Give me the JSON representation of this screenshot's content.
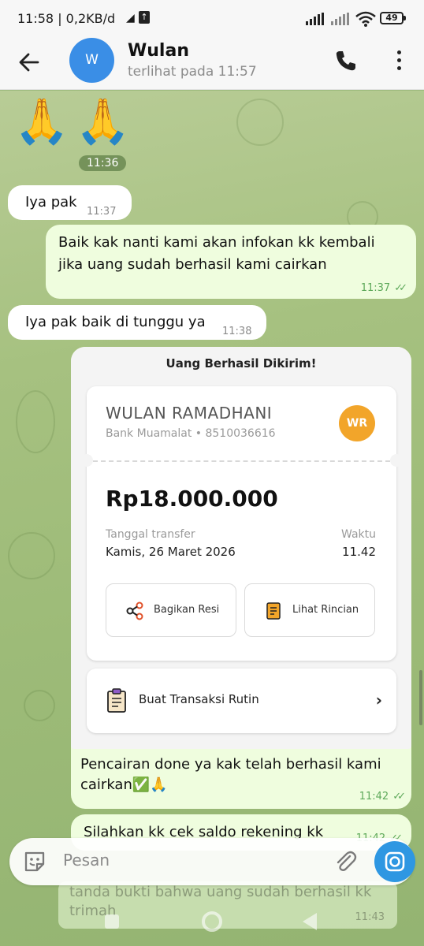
{
  "status_bar": {
    "time": "11:58 | 0,2KB/d",
    "battery": "49"
  },
  "header": {
    "avatar_initial": "W",
    "name": "Wulan",
    "status": "terlihat pada  11:57"
  },
  "messages": {
    "emoji": "🙏🙏",
    "emoji_time": "11:36",
    "m1": {
      "text": "Iya pak",
      "time": "11:37"
    },
    "m2": {
      "line1": "Baik kak nanti kami akan infokan kk kembali",
      "line2": "jika uang sudah berhasil kami cairkan",
      "time": "11:37"
    },
    "m3": {
      "text": "Iya pak baik di tunggu ya",
      "time": "11:38"
    },
    "m4": {
      "line1": "Pencairan done ya kak telah berhasil kami",
      "line2": "cairkan✅🙏",
      "time": "11:42"
    },
    "m5": {
      "text": "Silahkan kk cek saldo rekening kk",
      "time": "11:42"
    },
    "m6": {
      "line1": "tanda bukti bahwa uang sudah berhasil kk",
      "line2": "trimah",
      "time": "11:43"
    }
  },
  "receipt": {
    "title": "Uang Berhasil Dikirim!",
    "recipient_name": "WULAN RAMADHANI",
    "bank": "Bank Muamalat • 8510036616",
    "initials": "WR",
    "amount": "Rp18.000.000",
    "date_label": "Tanggal transfer",
    "date_value": "Kamis, 26 Maret 2026",
    "time_label": "Waktu",
    "time_value": "11.42",
    "share_label": "Bagikan Resi",
    "detail_label": "Lihat Rincian",
    "routine_label": "Buat Transaksi Rutin",
    "routine_arrow": "›"
  },
  "composer": {
    "placeholder": "Pesan"
  },
  "colors": {
    "header_bg": "#f7f7f7",
    "incoming": "#ffffff",
    "outgoing": "#effdde",
    "accent": "#2e97e2",
    "time_green": "#5ea95a",
    "avatar_blue": "#3a8ee6",
    "wr_orange": "#f2a52a"
  },
  "icons": [
    "telegram-icon",
    "upload-icon",
    "signal-icon",
    "wifi-icon",
    "battery-icon",
    "back-arrow-icon",
    "phone-icon",
    "more-icon",
    "share-icon",
    "receipt-icon",
    "clipboard-icon",
    "chevron-right-icon",
    "emoji-sticker-icon",
    "attach-icon",
    "camera-icon"
  ]
}
